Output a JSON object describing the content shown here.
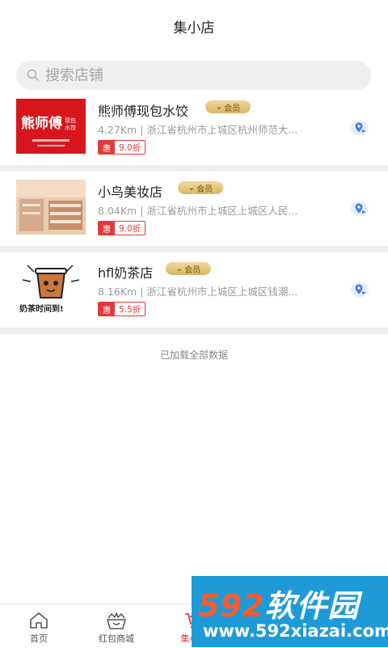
{
  "header": {
    "title": "集小店"
  },
  "search": {
    "placeholder": "搜索店铺"
  },
  "stores": [
    {
      "name": "熊师傅现包水饺",
      "member_label": "会员",
      "distance": "4.27Km",
      "address": "浙江省杭州市上城区杭州师范大...",
      "discount_tag": "惠",
      "discount": "9.0折",
      "thumb_text": "熊师傅",
      "thumb_sub": "现包水饺"
    },
    {
      "name": "小鸟美妆店",
      "member_label": "会员",
      "distance": "8.04Km",
      "address": "浙江省杭州市上城区上城区人民...",
      "discount_tag": "惠",
      "discount": "9.0折"
    },
    {
      "name": "hfl奶茶店",
      "member_label": "会员",
      "distance": "8.16Km",
      "address": "浙江省杭州市上城区上城区钱潮...",
      "discount_tag": "惠",
      "discount": "5.5折",
      "thumb_text": "奶茶时间到!"
    }
  ],
  "list_footer": "已加载全部数据",
  "tabbar": {
    "items": [
      {
        "label": "首页",
        "icon": "home-icon"
      },
      {
        "label": "红包商城",
        "icon": "crown-basket-icon"
      },
      {
        "label": "集小店",
        "icon": "cart-icon",
        "active": true
      }
    ]
  },
  "watermark": {
    "brand_num": "592",
    "brand_text": "软件园",
    "url": "www.592xiazai.com"
  },
  "colors": {
    "accent": "#e2393c",
    "member_gold": "#d9b566",
    "separator": "#eeeeee"
  }
}
